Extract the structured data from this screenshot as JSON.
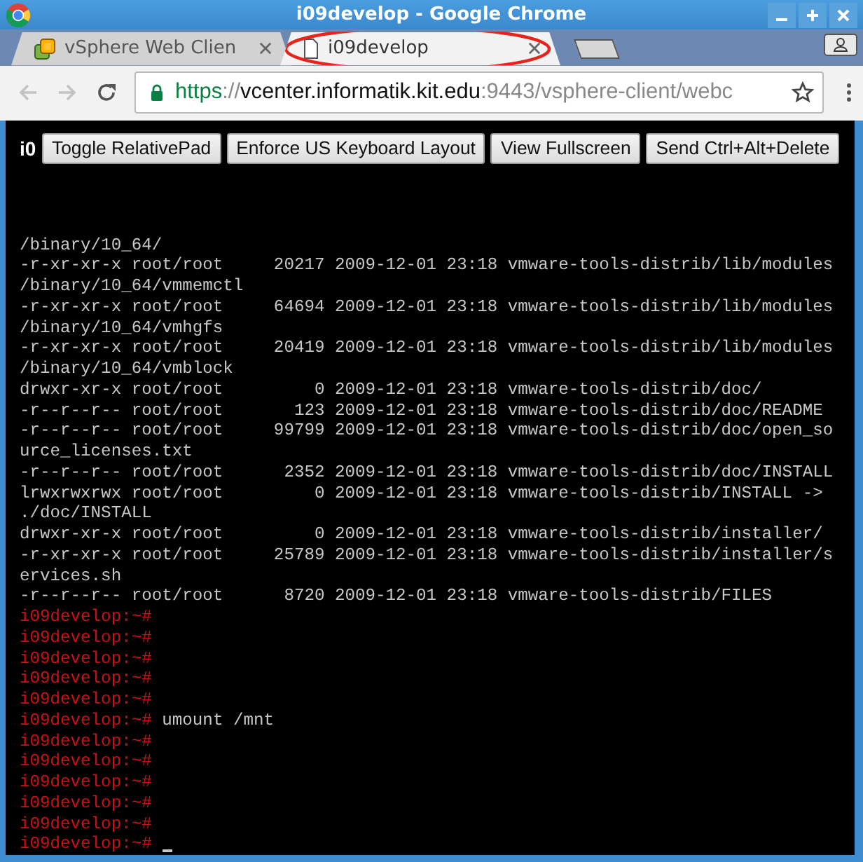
{
  "window": {
    "title": "i09develop - Google Chrome"
  },
  "tabs": [
    {
      "label": "vSphere Web Clien",
      "selected": false,
      "highlighted": false
    },
    {
      "label": "i09develop",
      "selected": true,
      "highlighted": true
    }
  ],
  "toolbar": {
    "back_disabled": true,
    "forward_disabled": true
  },
  "address": {
    "scheme": "https",
    "separator": "://",
    "host": "vcenter.informatik.kit.edu",
    "rest": ":9443/vsphere-client/webc",
    "secure": true
  },
  "console": {
    "header": "i0",
    "buttons": [
      "Toggle RelativePad",
      "Enforce US Keyboard Layout",
      "View Fullscreen",
      "Send Ctrl+Alt+Delete"
    ],
    "lines": [
      {
        "kind": "output",
        "text": "/binary/10_64/"
      },
      {
        "kind": "output",
        "text": "-r-xr-xr-x root/root     20217 2009-12-01 23:18 vmware-tools-distrib/lib/modules"
      },
      {
        "kind": "output",
        "text": "/binary/10_64/vmmemctl"
      },
      {
        "kind": "output",
        "text": "-r-xr-xr-x root/root     64694 2009-12-01 23:18 vmware-tools-distrib/lib/modules"
      },
      {
        "kind": "output",
        "text": "/binary/10_64/vmhgfs"
      },
      {
        "kind": "output",
        "text": "-r-xr-xr-x root/root     20419 2009-12-01 23:18 vmware-tools-distrib/lib/modules"
      },
      {
        "kind": "output",
        "text": "/binary/10_64/vmblock"
      },
      {
        "kind": "output",
        "text": "drwxr-xr-x root/root         0 2009-12-01 23:18 vmware-tools-distrib/doc/"
      },
      {
        "kind": "output",
        "text": "-r--r--r-- root/root       123 2009-12-01 23:18 vmware-tools-distrib/doc/README"
      },
      {
        "kind": "output",
        "text": "-r--r--r-- root/root     99799 2009-12-01 23:18 vmware-tools-distrib/doc/open_so"
      },
      {
        "kind": "output",
        "text": "urce_licenses.txt"
      },
      {
        "kind": "output",
        "text": "-r--r--r-- root/root      2352 2009-12-01 23:18 vmware-tools-distrib/doc/INSTALL"
      },
      {
        "kind": "output",
        "text": "lrwxrwxrwx root/root         0 2009-12-01 23:18 vmware-tools-distrib/INSTALL ->"
      },
      {
        "kind": "output",
        "text": "./doc/INSTALL"
      },
      {
        "kind": "output",
        "text": "drwxr-xr-x root/root         0 2009-12-01 23:18 vmware-tools-distrib/installer/"
      },
      {
        "kind": "output",
        "text": "-r-xr-xr-x root/root     25789 2009-12-01 23:18 vmware-tools-distrib/installer/s"
      },
      {
        "kind": "output",
        "text": "ervices.sh"
      },
      {
        "kind": "output",
        "text": "-r--r--r-- root/root      8720 2009-12-01 23:18 vmware-tools-distrib/FILES"
      },
      {
        "kind": "prompt",
        "prompt": "i09develop:~#"
      },
      {
        "kind": "prompt",
        "prompt": "i09develop:~#"
      },
      {
        "kind": "prompt",
        "prompt": "i09develop:~#"
      },
      {
        "kind": "prompt",
        "prompt": "i09develop:~#"
      },
      {
        "kind": "prompt",
        "prompt": "i09develop:~#"
      },
      {
        "kind": "prompt",
        "prompt": "i09develop:~#",
        "command": "umount /mnt"
      },
      {
        "kind": "prompt",
        "prompt": "i09develop:~#"
      },
      {
        "kind": "prompt",
        "prompt": "i09develop:~#"
      },
      {
        "kind": "prompt",
        "prompt": "i09develop:~#"
      },
      {
        "kind": "prompt",
        "prompt": "i09develop:~#"
      },
      {
        "kind": "prompt",
        "prompt": "i09develop:~#"
      },
      {
        "kind": "prompt",
        "prompt": "i09develop:~#",
        "cursor": true
      }
    ]
  }
}
